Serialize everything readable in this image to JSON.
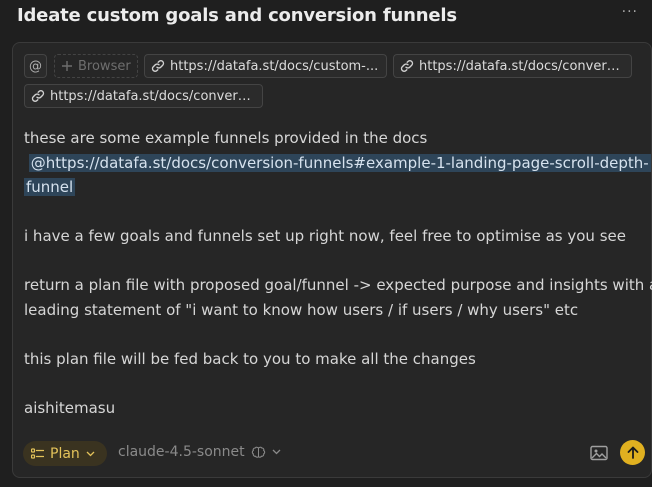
{
  "header": {
    "title": "Ideate custom goals and conversion funnels",
    "more_label": "···"
  },
  "context": {
    "at_label": "@",
    "browser_label": "Browser",
    "links": [
      "https://datafa.st/docs/custom-...",
      "https://datafa.st/docs/convers...",
      "https://datafa.st/docs/convers..."
    ]
  },
  "message": {
    "line1": "these are some example funnels provided in the docs",
    "mention_line1": "@https://datafa.st/docs/conversion-funnels#example-1-landing-page-scroll-depth-",
    "mention_line2": "funnel",
    "line3": "i have a few goals and funnels set up right now, feel free to optimise as you see",
    "line4a": "return a plan file with proposed goal/funnel -> expected purpose and insights with a",
    "line4b": "leading statement of \"i want to know how users / if users / why users\" etc",
    "line5": "this plan file will be fed back to you to make all the changes",
    "line6": "aishitemasu"
  },
  "footer": {
    "mode_label": "Plan",
    "model_label": "claude-4.5-sonnet"
  },
  "colors": {
    "accent": "#e0b020",
    "mention_bg": "#2e4559"
  }
}
